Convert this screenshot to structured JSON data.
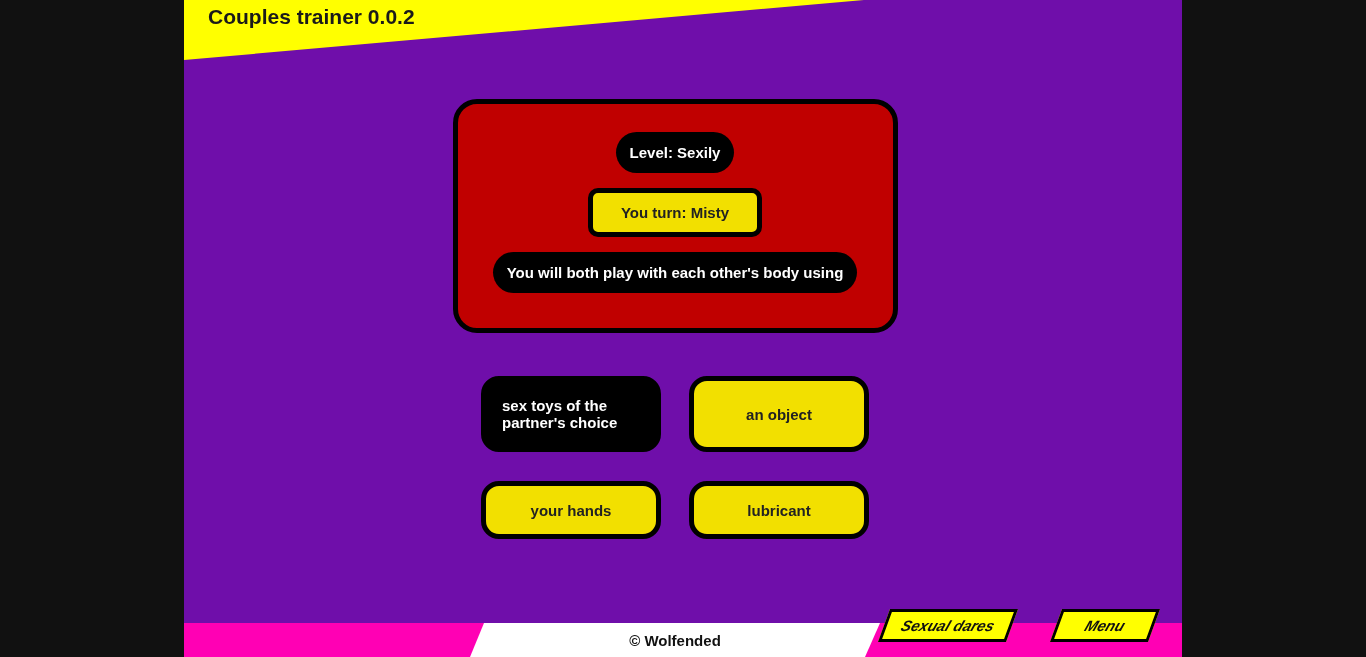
{
  "header": {
    "title": "Couples trainer 0.0.2"
  },
  "card": {
    "level": "Level: Sexily",
    "turn": "You turn: Misty",
    "prompt": "You will both play with each other's body using"
  },
  "options": [
    {
      "label": "sex toys of the partner's choice",
      "selected": true
    },
    {
      "label": "an object",
      "selected": false
    },
    {
      "label": "your hands",
      "selected": false
    },
    {
      "label": "lubricant",
      "selected": false
    }
  ],
  "footer": {
    "credit": "© Wolfended",
    "buttons": [
      "Sexual dares",
      "Menu"
    ]
  }
}
